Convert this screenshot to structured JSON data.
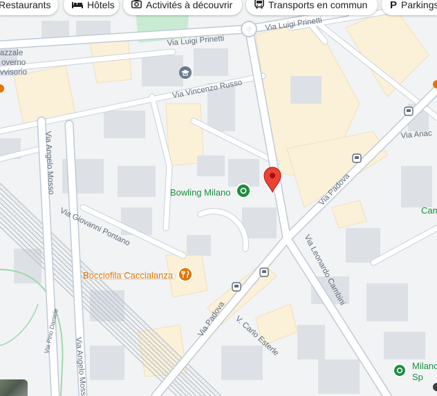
{
  "chips": [
    {
      "label": "Restaurants",
      "icon": "fork-knife-icon"
    },
    {
      "label": "Hôtels",
      "icon": "bed-icon"
    },
    {
      "label": "Activités à découvrir",
      "icon": "camera-icon"
    },
    {
      "label": "Transports en commun",
      "icon": "bus-icon"
    },
    {
      "label": "Parkings",
      "icon": "parking-icon",
      "glyph": "P"
    }
  ],
  "partial_labels": {
    "piazzale_1": "azzale",
    "piazzale_2": "overno",
    "piazzale_3": "vvisorio",
    "camp": "Cam",
    "milano_sport_1": "Milano",
    "milano_sport_2": "Sp"
  },
  "streets": {
    "prinetti_top": "Via Luigi Prinetti",
    "prinetti_mid": "Via Luigi Prinetti",
    "vincenzo_russo": "Via Vincenzo Russo",
    "angelo_mosso_top": "Via Angelo Mosso",
    "angelo_mosso_bottom": "Via Angelo Mosso",
    "giovanni_pontano": "Via Giovanni Pontano",
    "padova_upper": "Via Padova",
    "padova_lower": "Via Padova",
    "leonardo_cambini": "Via Leonardo Cambini",
    "carlo_esterle": "V. Carlo Esterle",
    "pino_daniele": "Via Pino Daniele",
    "anac": "Via Anac"
  },
  "pois": {
    "bowling": "Bowling Milano",
    "bocciofila": "Bocciofila Caccialanza"
  },
  "colors": {
    "map_bg": "#f1f3f4",
    "road": "#ffffff",
    "road_border": "#c8d1dc",
    "building": "#dde1e6",
    "highlight_building": "#fbf1d9",
    "park": "#c9ebd3",
    "green_poi": "#1e8e3e",
    "orange_poi": "#e37400",
    "pin_red": "#ea4335",
    "rail": "#a9b3bd"
  }
}
